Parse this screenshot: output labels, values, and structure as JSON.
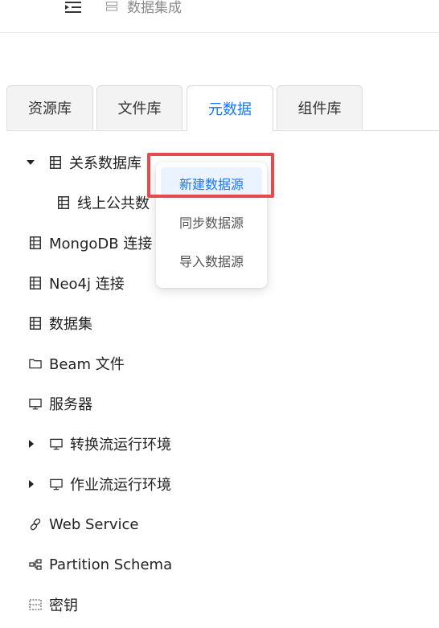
{
  "breadcrumb": {
    "current": "数据集成"
  },
  "tabs": [
    {
      "label": "资源库",
      "active": false
    },
    {
      "label": "文件库",
      "active": false
    },
    {
      "label": "元数据",
      "active": true
    },
    {
      "label": "组件库",
      "active": false
    }
  ],
  "tree": {
    "items": [
      {
        "label": "关系数据库",
        "icon": "database-icon",
        "expanded": true
      },
      {
        "label": "线上公共数",
        "icon": "database-icon"
      },
      {
        "label": "MongoDB 连接",
        "icon": "database-icon"
      },
      {
        "label": "Neo4j 连接",
        "icon": "database-icon"
      },
      {
        "label": "数据集",
        "icon": "database-icon"
      },
      {
        "label": "Beam 文件",
        "icon": "folder-icon"
      },
      {
        "label": "服务器",
        "icon": "monitor-icon"
      },
      {
        "label": "转换流运行环境",
        "icon": "monitor-icon",
        "expanded": false
      },
      {
        "label": "作业流运行环境",
        "icon": "monitor-icon",
        "expanded": false
      },
      {
        "label": "Web Service",
        "icon": "link-icon"
      },
      {
        "label": "Partition Schema",
        "icon": "partition-icon"
      },
      {
        "label": "密钥",
        "icon": "key-grid-icon"
      }
    ]
  },
  "context_menu": {
    "items": [
      {
        "label": "新建数据源",
        "highlighted": true
      },
      {
        "label": "同步数据源"
      },
      {
        "label": "导入数据源"
      }
    ]
  },
  "colors": {
    "accent": "#1677ff",
    "highlight_box": "#e54b4b",
    "menu_hover_bg": "#eaf3ff"
  }
}
